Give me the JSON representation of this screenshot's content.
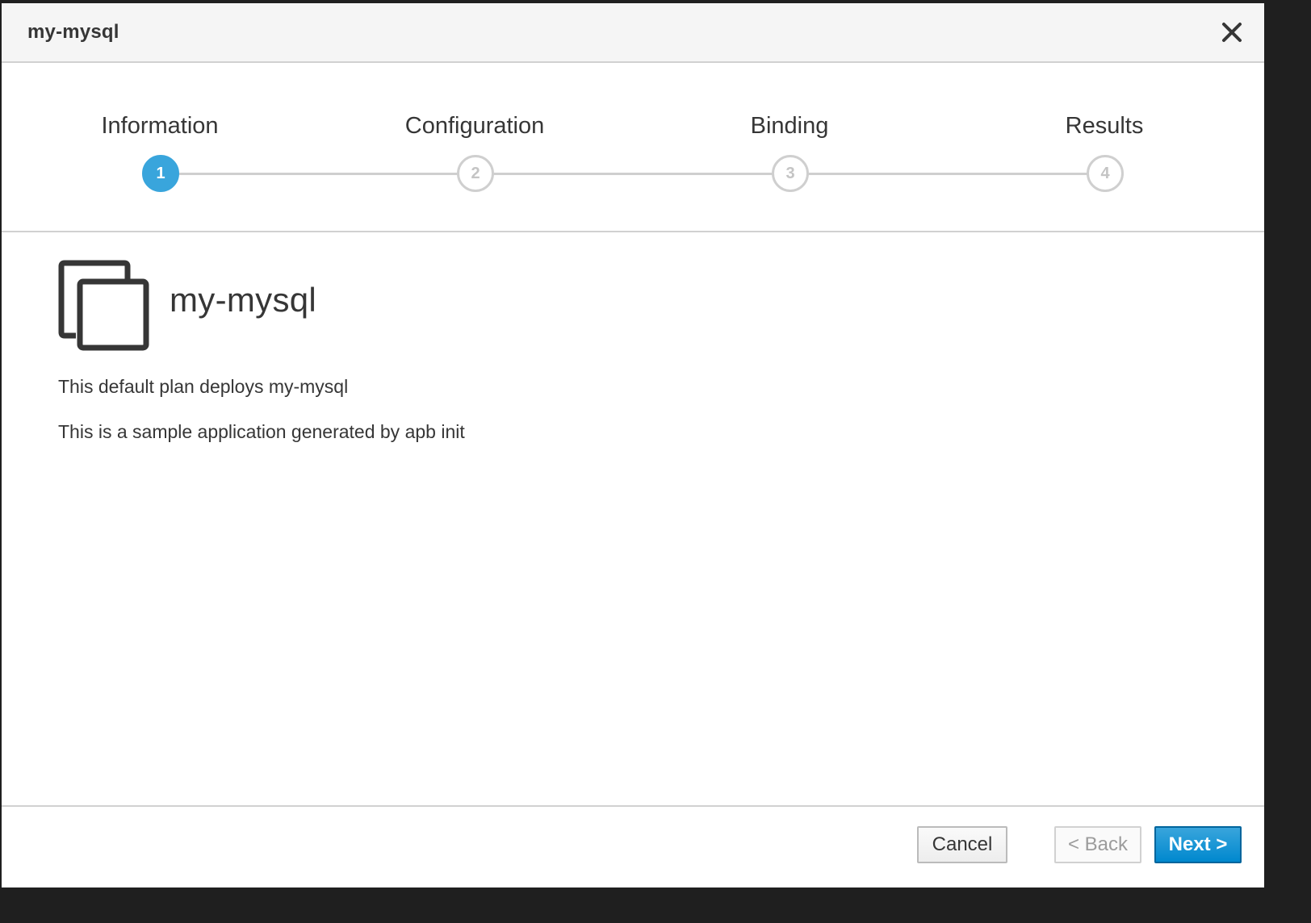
{
  "dialog": {
    "title": "my-mysql",
    "close_icon": "close-icon"
  },
  "wizard": {
    "steps": [
      {
        "number": "1",
        "label": "Information",
        "active": true
      },
      {
        "number": "2",
        "label": "Configuration",
        "active": false
      },
      {
        "number": "3",
        "label": "Binding",
        "active": false
      },
      {
        "number": "4",
        "label": "Results",
        "active": false
      }
    ],
    "active_color": "#39a5dc"
  },
  "service": {
    "icon": "copy-icon",
    "name": "my-mysql",
    "plan_description": "This default plan deploys my-mysql",
    "description": "This is a sample application generated by apb init"
  },
  "footer": {
    "cancel_label": "Cancel",
    "back_label": "< Back",
    "next_label": "Next >"
  }
}
